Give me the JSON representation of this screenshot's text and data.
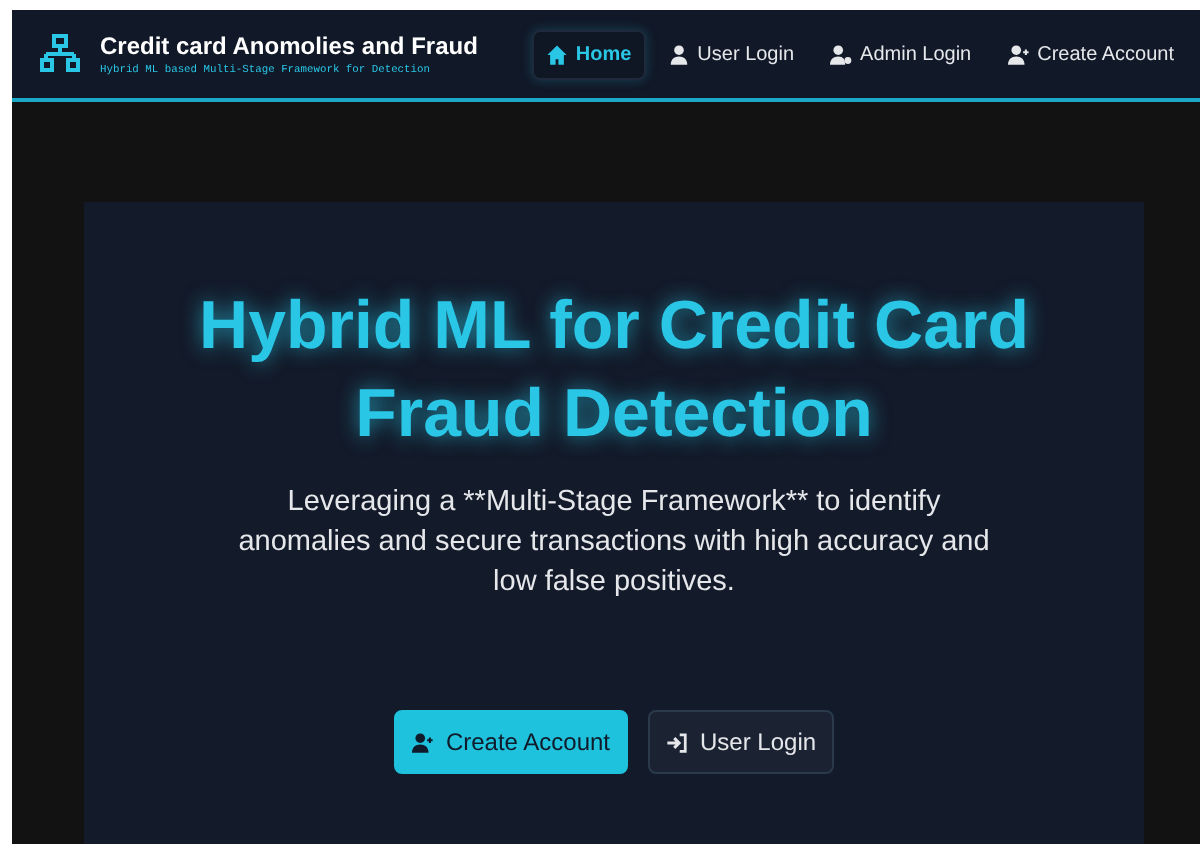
{
  "brand": {
    "title": "Credit card Anomolies and Fraud",
    "subtitle": "Hybrid ML based Multi-Stage Framework for Detection"
  },
  "nav": [
    {
      "label": "Home",
      "kind": "home",
      "selected": true
    },
    {
      "label": "User Login",
      "kind": "user",
      "selected": false
    },
    {
      "label": "Admin Login",
      "kind": "admin",
      "selected": false
    },
    {
      "label": "Create Account",
      "kind": "adduser",
      "selected": false
    }
  ],
  "hero": {
    "title": "Hybrid ML for Credit Card Fraud Detection",
    "description": "Leveraging a **Multi-Stage Framework** to identify anomalies and secure transactions with high accuracy and low false positives.",
    "buttons": [
      {
        "label": "Create Account",
        "kind": "adduser",
        "primary": true
      },
      {
        "label": "User Login",
        "kind": "login",
        "primary": false
      }
    ]
  }
}
